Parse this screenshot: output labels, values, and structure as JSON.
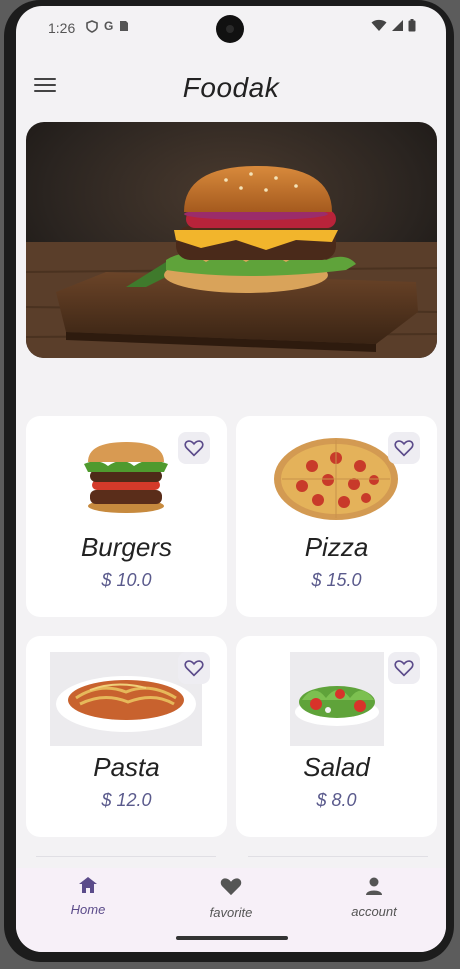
{
  "status_bar": {
    "time": "1:26",
    "icons_left": [
      "shield-icon",
      "google-icon",
      "sim-icon"
    ],
    "icons_right": [
      "wifi-icon",
      "signal-icon",
      "battery-icon"
    ]
  },
  "app_bar": {
    "title": "Foodak",
    "menu_icon": "menu-icon"
  },
  "hero": {
    "alt": "burger on wooden board"
  },
  "items": [
    {
      "name": "Burgers",
      "price": "$ 10.0",
      "favorite": false
    },
    {
      "name": "Pizza",
      "price": "$ 15.0",
      "favorite": false
    },
    {
      "name": "Pasta",
      "price": "$ 12.0",
      "favorite": false
    },
    {
      "name": "Salad",
      "price": "$ 8.0",
      "favorite": false
    }
  ],
  "bottom_nav": {
    "items": [
      {
        "label": "Home",
        "icon": "home-icon",
        "active": true
      },
      {
        "label": "favorite",
        "icon": "heart-icon",
        "active": false
      },
      {
        "label": "account",
        "icon": "person-icon",
        "active": false
      }
    ]
  },
  "colors": {
    "accent": "#5b4b8a",
    "background": "#f3f2f4",
    "price": "#5a5a8c",
    "nav_background": "#f7f0f8"
  }
}
